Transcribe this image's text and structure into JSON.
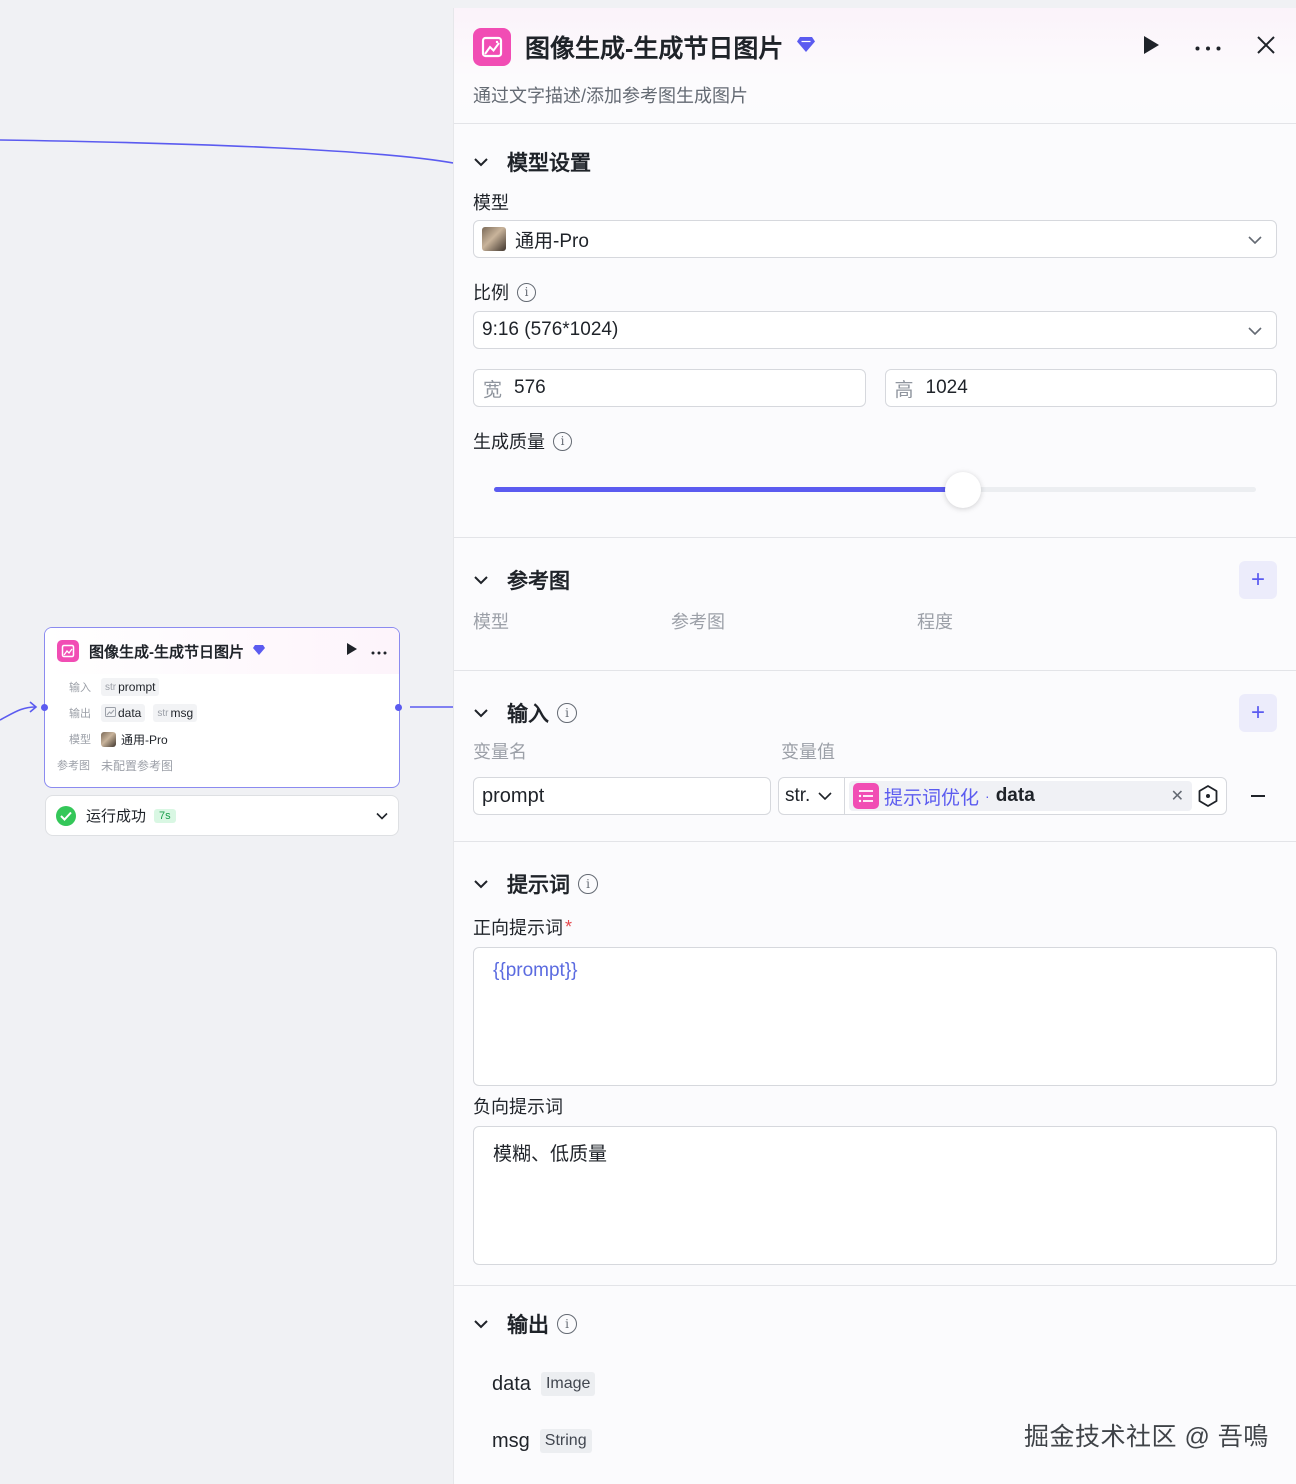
{
  "node": {
    "title": "图像生成-生成节日图片",
    "input_label": "输入",
    "input_tags": [
      {
        "prefix": "str",
        "name": "prompt"
      }
    ],
    "output_label": "输出",
    "output_tags": [
      {
        "prefix": "img",
        "name": "data"
      },
      {
        "prefix": "str",
        "name": "msg"
      }
    ],
    "model_label": "模型",
    "model_value": "通用-Pro",
    "ref_label": "参考图",
    "ref_value": "未配置参考图",
    "status_text": "运行成功",
    "status_time": "7s"
  },
  "panel": {
    "title": "图像生成-生成节日图片",
    "description": "通过文字描述/添加参考图生成图片",
    "model_settings": {
      "title": "模型设置",
      "model_label": "模型",
      "model_value": "通用-Pro",
      "ratio_label": "比例",
      "ratio_value": "9:16 (576*1024)",
      "width_prefix": "宽",
      "width_value": "576",
      "height_prefix": "高",
      "height_value": "1024",
      "quality_label": "生成质量",
      "quality_level": 0.615
    },
    "reference": {
      "title": "参考图",
      "columns": [
        "模型",
        "参考图",
        "程度"
      ]
    },
    "inputs": {
      "title": "输入",
      "columns": [
        "变量名",
        "变量值"
      ],
      "rows": [
        {
          "name": "prompt",
          "type": "str.",
          "ref_node": "提示词优化",
          "ref_var": "data"
        }
      ]
    },
    "prompts": {
      "title": "提示词",
      "positive_label": "正向提示词",
      "required_mark": "*",
      "positive_value": "{{prompt}}",
      "negative_label": "负向提示词",
      "negative_value": "模糊、低质量"
    },
    "outputs": {
      "title": "输出",
      "items": [
        {
          "name": "data",
          "type": "Image"
        },
        {
          "name": "msg",
          "type": "String"
        }
      ]
    }
  },
  "watermark": "掘金技术社区 @ 吾鳴",
  "colors": {
    "accent": "#5b5bf0",
    "node_icon": "#f14db4",
    "success": "#34c759"
  }
}
